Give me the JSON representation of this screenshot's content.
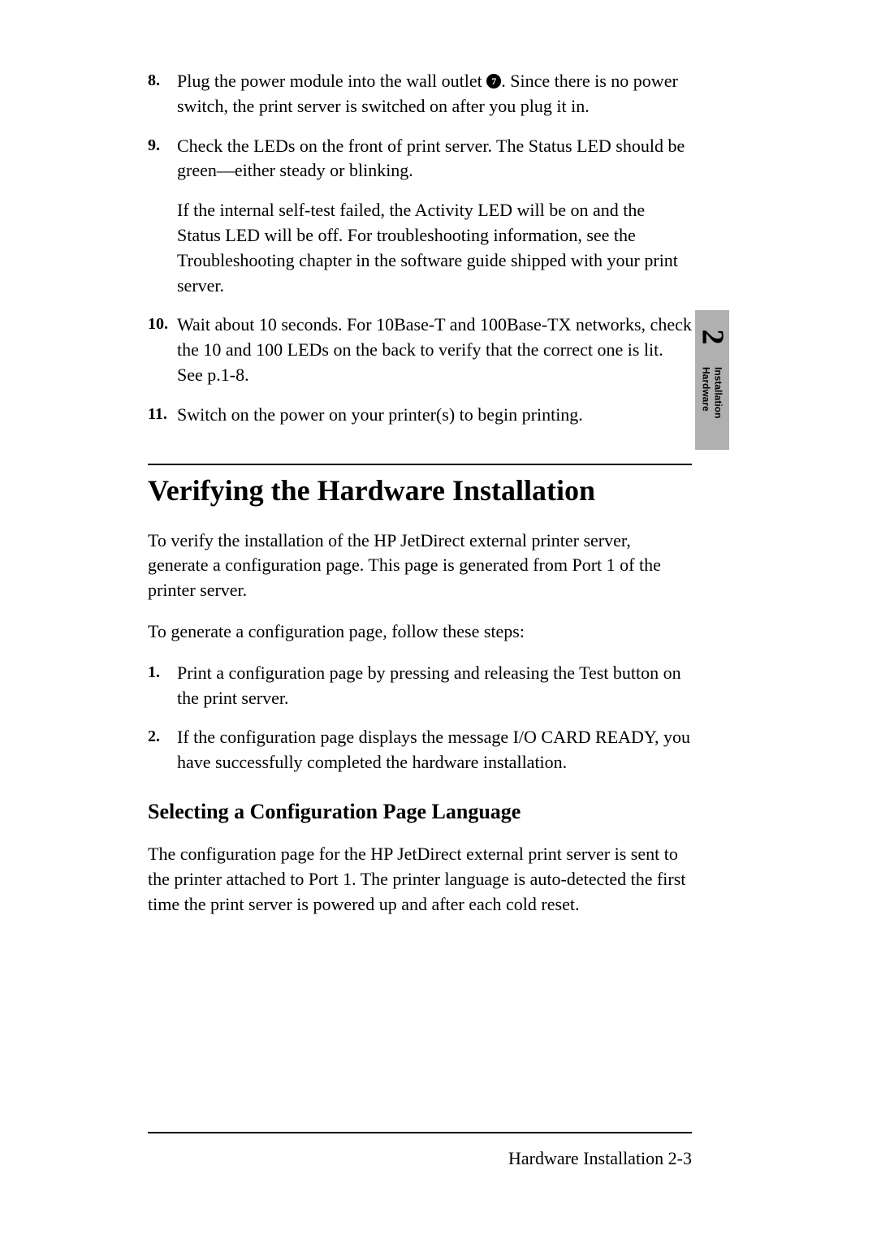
{
  "steps": {
    "s8": {
      "num": "8.",
      "text_before": "Plug the power module into the wall outlet ",
      "circled": "7",
      "text_after": ". Since there is no power switch, the print server is switched on after you plug it in."
    },
    "s9": {
      "num": "9.",
      "p1": "Check the LEDs on the front of print server. The Status LED should be green—either steady or blinking.",
      "p2": "If the internal self-test failed, the Activity LED will be on and the Status LED will be off. For troubleshooting information, see the Troubleshooting chapter in the software guide shipped with your print server."
    },
    "s10": {
      "num": "10.",
      "p1": "Wait about 10 seconds. For 10Base-T and 100Base-TX networks, check the 10 and 100 LEDs on the back to verify that the correct one is lit. See p.1-8."
    },
    "s11": {
      "num": "11.",
      "p1": "Switch on the power on your printer(s) to begin printing."
    }
  },
  "heading1": "Verifying the Hardware Installation",
  "para1": "To verify the installation of the HP JetDirect external printer server, generate a configuration page. This page is generated from Port 1 of the printer server.",
  "para2": "To generate a configuration page, follow these steps:",
  "verify_steps": {
    "v1": {
      "num": "1.",
      "p1": "Print a configuration page by pressing and releasing the Test button on the print server."
    },
    "v2": {
      "num": "2.",
      "p1": "If the configuration page displays the message I/O CARD READY, you have successfully completed the hardware installation."
    }
  },
  "heading2": "Selecting a Configuration Page Language",
  "para3": "The configuration page for the HP JetDirect external print server is sent to the printer attached to Port 1. The printer language is auto-detected the first time the print server is powered up and after each cold reset.",
  "tab": {
    "num": "2",
    "label1": "Hardware",
    "label2": "Installation"
  },
  "footer": "Hardware Installation 2-3"
}
